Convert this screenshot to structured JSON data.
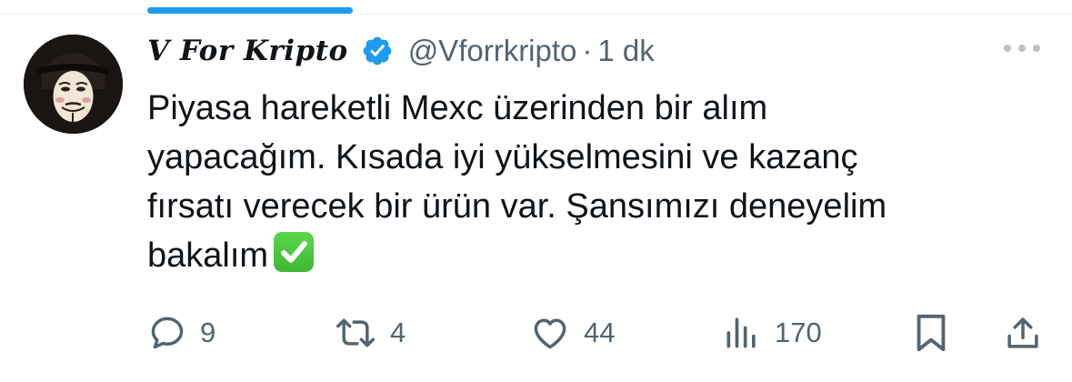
{
  "tweet": {
    "display_name": "V For Kripto",
    "handle": "@Vforrkripto",
    "separator": "·",
    "time": "1 dk",
    "text": "Piyasa hareketli Mexc üzerinden bir alım\nyapacağım. Kısada iyi yükselmesini ve kazanç\nfırsatı verecek bir ürün var. Şansımızı deneyelim\nbakalım",
    "emoji": "white-check-mark",
    "verified": true
  },
  "actions": {
    "replies": "9",
    "reposts": "4",
    "likes": "44",
    "views": "170"
  },
  "icons": {
    "verified": "verified-badge-icon",
    "more": "more-options-icon",
    "reply": "reply-icon",
    "repost": "repost-icon",
    "like": "like-icon",
    "views": "views-icon",
    "bookmark": "bookmark-icon",
    "share": "share-icon"
  },
  "colors": {
    "accent": "#1d9bf0",
    "text": "#0f1419",
    "secondary": "#536471",
    "check": "#3fb835"
  }
}
